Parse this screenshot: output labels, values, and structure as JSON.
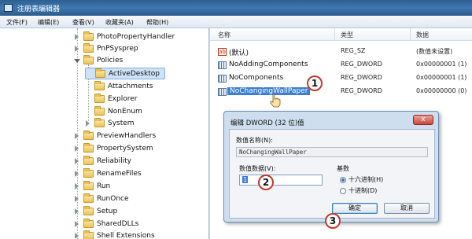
{
  "window": {
    "title": "注册表编辑器"
  },
  "menu": [
    "文件(F)",
    "编辑(E)",
    "查看(V)",
    "收藏夹(A)",
    "帮助(H)"
  ],
  "tree": {
    "items": [
      {
        "label": "PhotoPropertyHandler",
        "state": "closed"
      },
      {
        "label": "PnPSysprep",
        "state": "closed"
      },
      {
        "label": "Policies",
        "state": "open"
      },
      {
        "label": "ActiveDesktop",
        "state": "none",
        "selected": true
      },
      {
        "label": "Attachments",
        "state": "none"
      },
      {
        "label": "Explorer",
        "state": "none"
      },
      {
        "label": "NonEnum",
        "state": "none"
      },
      {
        "label": "System",
        "state": "closed"
      },
      {
        "label": "PreviewHandlers",
        "state": "closed"
      },
      {
        "label": "PropertySystem",
        "state": "closed"
      },
      {
        "label": "Reliability",
        "state": "closed"
      },
      {
        "label": "RenameFiles",
        "state": "closed"
      },
      {
        "label": "Run",
        "state": "closed"
      },
      {
        "label": "RunOnce",
        "state": "closed"
      },
      {
        "label": "Setup",
        "state": "closed"
      },
      {
        "label": "SharedDLLs",
        "state": "closed"
      },
      {
        "label": "Shell Extensions",
        "state": "closed"
      }
    ]
  },
  "values": {
    "headers": {
      "name": "名称",
      "type": "类型",
      "data": "数据"
    },
    "rows": [
      {
        "name": "(默认)",
        "type": "REG_SZ",
        "data": "(数值未设置)",
        "icon": "string-value-icon"
      },
      {
        "name": "NoAddingComponents",
        "type": "REG_DWORD",
        "data": "0x00000001 (1)",
        "icon": "dword-value-icon"
      },
      {
        "name": "NoComponents",
        "type": "REG_DWORD",
        "data": "0x00000001 (1)",
        "icon": "dword-value-icon"
      },
      {
        "name": "NoChangingWallPaper",
        "type": "REG_DWORD",
        "data": "0x00000000 (0)",
        "icon": "dword-value-icon",
        "highlighted": true
      }
    ]
  },
  "dialog": {
    "title": "编辑 DWORD (32 位)值",
    "close": "x",
    "name_label": "数值名称(N):",
    "name_value": "NoChangingWallPaper",
    "data_label": "数值数据(V):",
    "data_value": "1",
    "base_label": "基数",
    "radio_hex": "十六进制(H)",
    "radio_dec": "十进制(D)",
    "base_selected": "hex",
    "ok": "确定",
    "cancel": "取消"
  },
  "callouts": [
    "1",
    "2",
    "3"
  ]
}
